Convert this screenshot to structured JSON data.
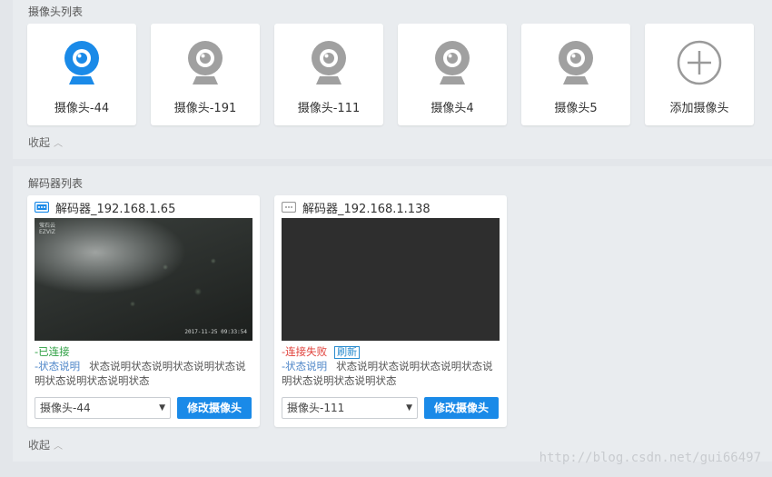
{
  "cameras": {
    "title": "摄像头列表",
    "items": [
      {
        "label": "摄像头-44",
        "color": "#1a8ae8",
        "icon": "webcam-icon"
      },
      {
        "label": "摄像头-191",
        "color": "#a0a0a0",
        "icon": "webcam-icon"
      },
      {
        "label": "摄像头-111",
        "color": "#a0a0a0",
        "icon": "webcam-icon"
      },
      {
        "label": "摄像头4",
        "color": "#a0a0a0",
        "icon": "webcam-icon"
      },
      {
        "label": "摄像头5",
        "color": "#a0a0a0",
        "icon": "webcam-icon"
      }
    ],
    "add_label": "添加摄像头",
    "add_icon": "plus-circle-icon",
    "collapse_label": "收起"
  },
  "decoders": {
    "title": "解码器列表",
    "items": [
      {
        "title": "解码器_192.168.1.65",
        "icon_color": "#1a8ae8",
        "video_brand": "萤石云",
        "video_brand_sub": "EZVIZ",
        "video_timestamp": "2017-11-25  09:33:54",
        "status": "已连接",
        "status_prefix": "-",
        "desc_label": "-状态说明",
        "desc_text": "状态说明状态说明状态说明状态说明状态说明状态说明状态",
        "select_value": "摄像头-44",
        "button_label": "修改摄像头"
      },
      {
        "title": "解码器_192.168.1.138",
        "icon_color": "#9a9a9a",
        "status": "连接失败",
        "status_prefix": "-",
        "refresh_label": "刷新",
        "desc_label": "-状态说明",
        "desc_text": "状态说明状态说明状态说明状态说明状态说明状态说明状态",
        "select_value": "摄像头-111",
        "button_label": "修改摄像头"
      }
    ],
    "collapse_label": "收起"
  },
  "watermark": "http://blog.csdn.net/gui66497",
  "colors": {
    "accent": "#1a8ae8",
    "ok": "#2ea043",
    "fail": "#e0403a"
  }
}
